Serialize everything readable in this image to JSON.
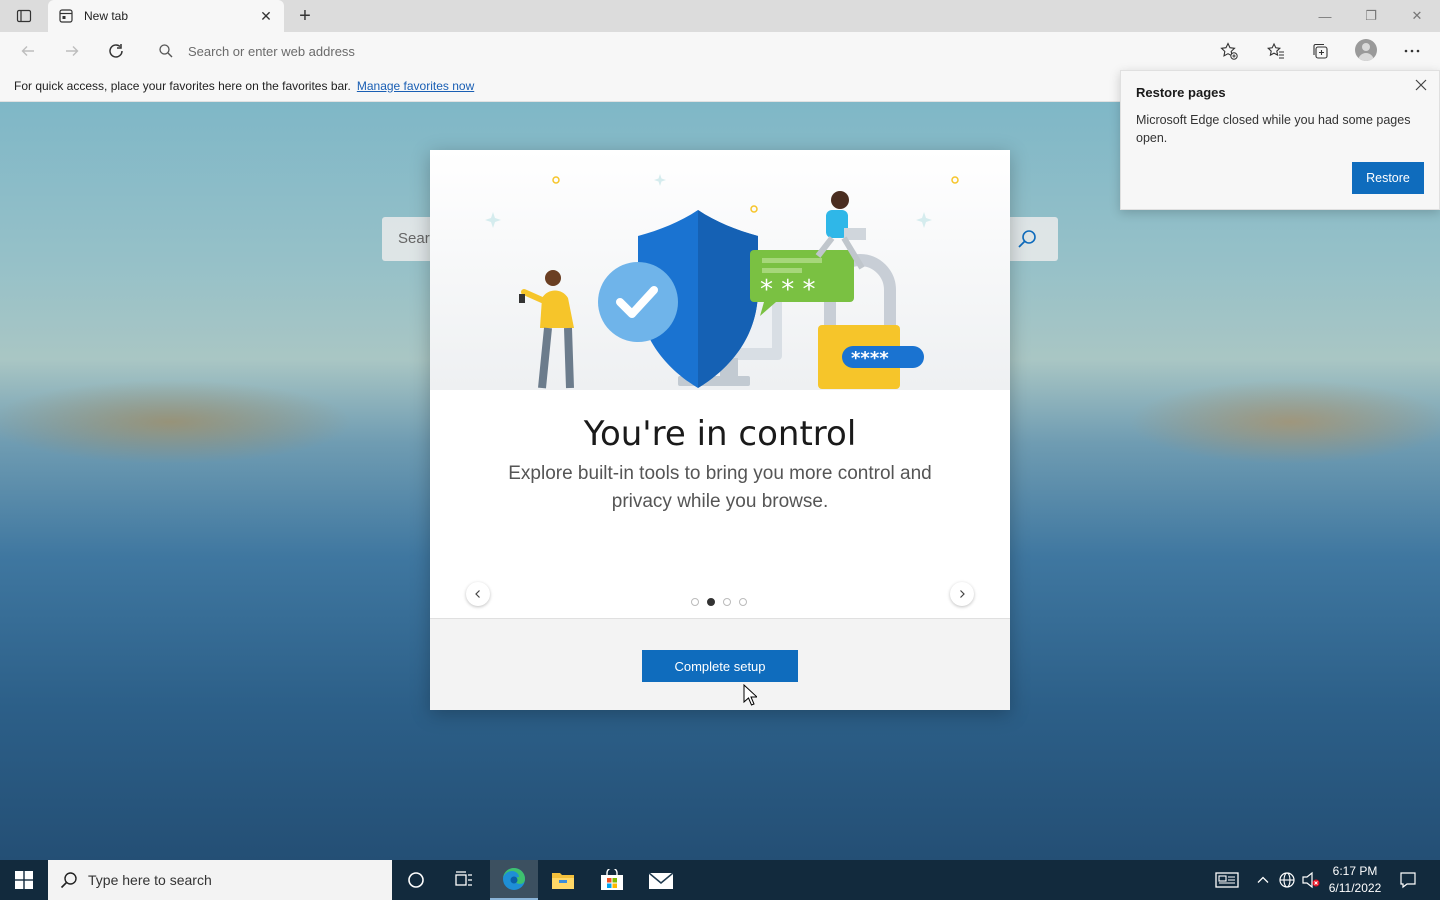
{
  "browser": {
    "tab_title": "New tab",
    "address_placeholder": "Search or enter web address"
  },
  "favorites_bar": {
    "message": "For quick access, place your favorites here on the favorites bar.",
    "link": "Manage favorites now"
  },
  "page": {
    "search_placeholder": "Sear"
  },
  "dialog": {
    "title": "You're in control",
    "body": "Explore built-in tools to bring you more control and privacy while you browse.",
    "carousel": {
      "pages": 4,
      "active_page": 2
    },
    "primary_button": "Complete setup",
    "hero_password_text": "* * *",
    "hero_pin_text": "****"
  },
  "restore_flyout": {
    "title": "Restore pages",
    "body": "Microsoft Edge closed while you had some pages open.",
    "button": "Restore"
  },
  "taskbar": {
    "search_placeholder": "Type here to search",
    "time": "6:17 PM",
    "date": "6/11/2022"
  },
  "colors": {
    "accent": "#0f6cbd",
    "shield_blue": "#1a73d1",
    "chat_green": "#7ac142",
    "lock_yellow": "#f6c52a"
  }
}
